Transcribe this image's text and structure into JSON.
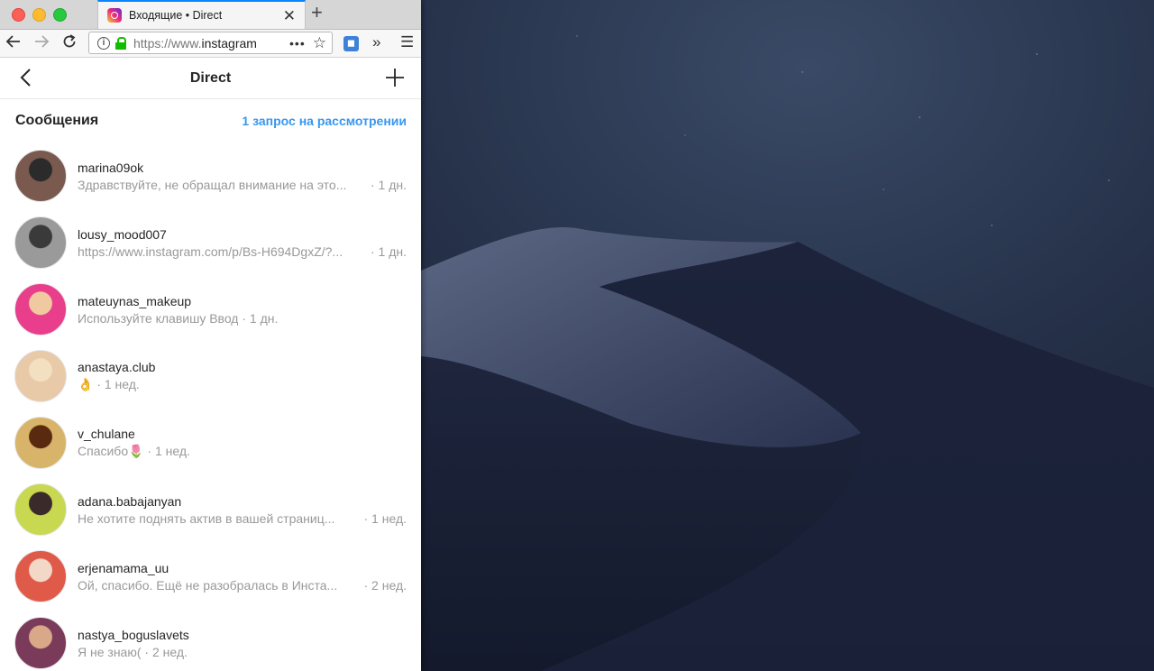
{
  "browser": {
    "tab_title": "Входящие • Direct",
    "url_prefix": "https://www.",
    "url_host": "instagram",
    "url_dots": "•••"
  },
  "direct": {
    "title": "Direct",
    "section_title": "Сообщения",
    "requests_link": "1 запрос на рассмотрении"
  },
  "threads": [
    {
      "name": "marina09ok",
      "message": "Здравствуйте, не обращал внимание на это...",
      "time": "· 1 дн.",
      "full": true,
      "avatar_color": "#7a5a4e",
      "avatar_color2": "#2b2b2b"
    },
    {
      "name": "lousy_mood007",
      "message": "https://www.instagram.com/p/Bs-H694DgxZ/?...",
      "time": "· 1 дн.",
      "full": true,
      "avatar_color": "#9a9a9a",
      "avatar_color2": "#3a3a3a"
    },
    {
      "name": "mateuynas_makeup",
      "message": "Используйте клавишу Ввод",
      "time": "· 1 дн.",
      "full": false,
      "avatar_color": "#e83e8c",
      "avatar_color2": "#f0c9a0"
    },
    {
      "name": "anastaya.club",
      "message": "👌",
      "time": "· 1 нед.",
      "full": false,
      "avatar_color": "#e8c9a8",
      "avatar_color2": "#f3e0c0"
    },
    {
      "name": "v_chulane",
      "message": "Спасибо🌷",
      "time": "· 1 нед.",
      "full": false,
      "avatar_color": "#d8b46a",
      "avatar_color2": "#5a2a10"
    },
    {
      "name": "adana.babajanyan",
      "message": "Не хотите поднять актив в вашей страниц...",
      "time": "· 1 нед.",
      "full": true,
      "avatar_color": "#c8d850",
      "avatar_color2": "#3a2a2a"
    },
    {
      "name": "erjenamama_uu",
      "message": "Ой, спасибо. Ещё не разобралась в Инста...",
      "time": "· 2 нед.",
      "full": true,
      "avatar_color": "#e05a4a",
      "avatar_color2": "#f3d8c8"
    },
    {
      "name": "nastya_boguslavets",
      "message": "Я не знаю(",
      "time": "· 2 нед.",
      "full": false,
      "avatar_color": "#7a3a5a",
      "avatar_color2": "#d8a888"
    }
  ]
}
